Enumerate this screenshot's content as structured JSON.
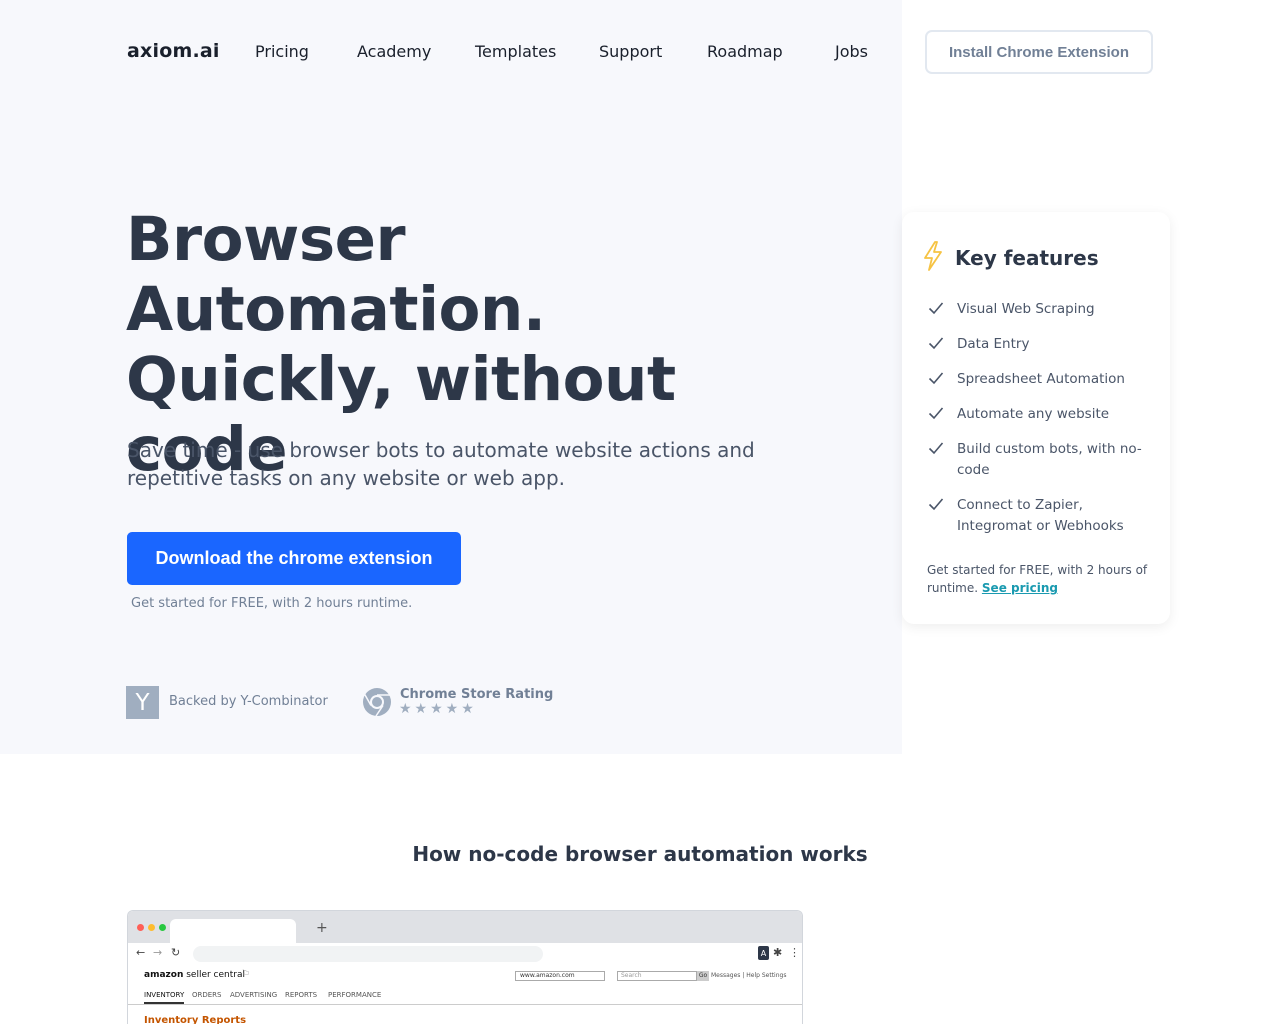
{
  "header": {
    "logo": "axiom.ai",
    "nav": [
      "Pricing",
      "Academy",
      "Templates",
      "Support",
      "Roadmap",
      "Jobs"
    ],
    "install_button": "Install Chrome Extension"
  },
  "hero": {
    "title_lines": [
      "Browser Automation.",
      "Quickly, without",
      "code"
    ],
    "subtitle": "Save time - use browser bots to automate website actions and repetitive tasks on any website or web app.",
    "cta_button": "Download the chrome extension",
    "cta_note": "Get started for FREE, with 2 hours runtime.",
    "yc_letter": "Y",
    "yc_label": "Backed by Y-Combinator",
    "chrome_label": "Chrome Store Rating",
    "stars": "★★★★★",
    "rating_stars": 5
  },
  "features": {
    "title": "Key features",
    "items": [
      "Visual Web Scraping",
      "Data Entry",
      "Spreadsheet Automation",
      "Automate any website",
      "Build custom bots, with no-code",
      "Connect to Zapier, Integromat or Webhooks"
    ],
    "note_prefix": "Get started for FREE, with 2 hours of runtime.",
    "note_link": "See pricing"
  },
  "how": {
    "title": "How no-code browser automation works"
  },
  "browser_mock": {
    "new_tab": "+",
    "ext_letter": "A",
    "seller_logo_bold": "amazon",
    "seller_logo_rest": " seller central",
    "select_value": "www.amazon.com",
    "search_placeholder": "Search",
    "go": "Go",
    "links": "Messages | Help   Settings",
    "menu": [
      "INVENTORY",
      "ORDERS",
      "ADVERTISING",
      "REPORTS",
      "PERFORMANCE"
    ],
    "report_title": "Inventory Reports"
  },
  "colors": {
    "primary": "#1a66ff",
    "hero_bg": "#f7f8fc",
    "heading": "#2d3748",
    "link_accent": "#1a9ab0",
    "bolt": "#f6c343"
  }
}
